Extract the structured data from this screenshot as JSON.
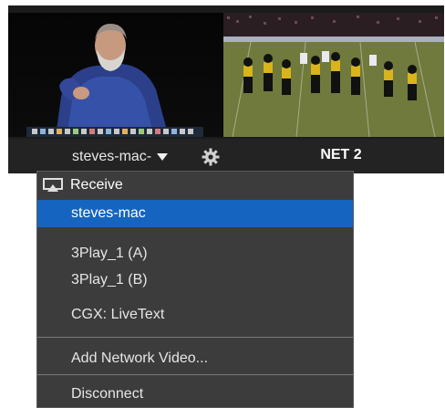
{
  "monitor": {
    "source_label": "steves-mac-",
    "net_label": "NET 2"
  },
  "menu": {
    "header_label": "Receive",
    "items": [
      {
        "label": "steves-mac",
        "selected": true
      },
      {
        "label": "3Play_1 (A)"
      },
      {
        "label": "3Play_1 (B)"
      },
      {
        "label": "CGX: LiveText"
      },
      {
        "label": "Add Network Video..."
      },
      {
        "label": "Disconnect"
      }
    ]
  },
  "colors": {
    "selection": "#1565c0",
    "menu_background": "#3c3c3c",
    "monitor_bar": "#232323"
  },
  "icons": [
    "chevron-down-icon",
    "gear-icon",
    "airplay-icon"
  ]
}
